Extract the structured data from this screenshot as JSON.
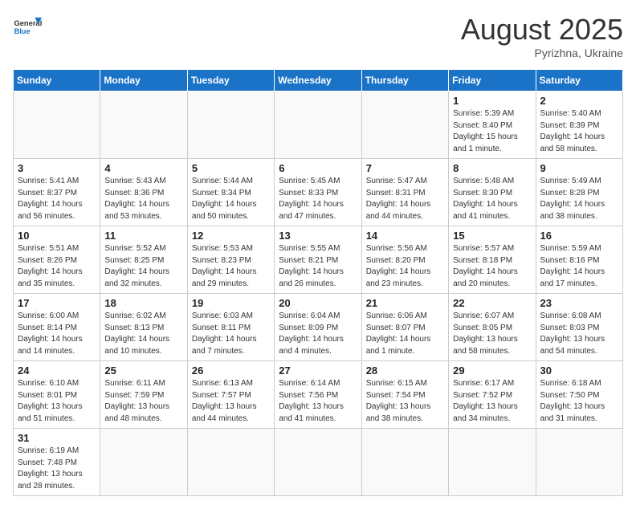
{
  "logo": {
    "text_general": "General",
    "text_blue": "Blue"
  },
  "header": {
    "month_year": "August 2025",
    "location": "Pyrizhna, Ukraine"
  },
  "weekdays": [
    "Sunday",
    "Monday",
    "Tuesday",
    "Wednesday",
    "Thursday",
    "Friday",
    "Saturday"
  ],
  "days": [
    {
      "date": 1,
      "col": 5,
      "sunrise": "5:39 AM",
      "sunset": "8:40 PM",
      "daylight": "15 hours and 1 minute."
    },
    {
      "date": 2,
      "col": 6,
      "sunrise": "5:40 AM",
      "sunset": "8:39 PM",
      "daylight": "14 hours and 58 minutes."
    },
    {
      "date": 3,
      "col": 0,
      "sunrise": "5:41 AM",
      "sunset": "8:37 PM",
      "daylight": "14 hours and 56 minutes."
    },
    {
      "date": 4,
      "col": 1,
      "sunrise": "5:43 AM",
      "sunset": "8:36 PM",
      "daylight": "14 hours and 53 minutes."
    },
    {
      "date": 5,
      "col": 2,
      "sunrise": "5:44 AM",
      "sunset": "8:34 PM",
      "daylight": "14 hours and 50 minutes."
    },
    {
      "date": 6,
      "col": 3,
      "sunrise": "5:45 AM",
      "sunset": "8:33 PM",
      "daylight": "14 hours and 47 minutes."
    },
    {
      "date": 7,
      "col": 4,
      "sunrise": "5:47 AM",
      "sunset": "8:31 PM",
      "daylight": "14 hours and 44 minutes."
    },
    {
      "date": 8,
      "col": 5,
      "sunrise": "5:48 AM",
      "sunset": "8:30 PM",
      "daylight": "14 hours and 41 minutes."
    },
    {
      "date": 9,
      "col": 6,
      "sunrise": "5:49 AM",
      "sunset": "8:28 PM",
      "daylight": "14 hours and 38 minutes."
    },
    {
      "date": 10,
      "col": 0,
      "sunrise": "5:51 AM",
      "sunset": "8:26 PM",
      "daylight": "14 hours and 35 minutes."
    },
    {
      "date": 11,
      "col": 1,
      "sunrise": "5:52 AM",
      "sunset": "8:25 PM",
      "daylight": "14 hours and 32 minutes."
    },
    {
      "date": 12,
      "col": 2,
      "sunrise": "5:53 AM",
      "sunset": "8:23 PM",
      "daylight": "14 hours and 29 minutes."
    },
    {
      "date": 13,
      "col": 3,
      "sunrise": "5:55 AM",
      "sunset": "8:21 PM",
      "daylight": "14 hours and 26 minutes."
    },
    {
      "date": 14,
      "col": 4,
      "sunrise": "5:56 AM",
      "sunset": "8:20 PM",
      "daylight": "14 hours and 23 minutes."
    },
    {
      "date": 15,
      "col": 5,
      "sunrise": "5:57 AM",
      "sunset": "8:18 PM",
      "daylight": "14 hours and 20 minutes."
    },
    {
      "date": 16,
      "col": 6,
      "sunrise": "5:59 AM",
      "sunset": "8:16 PM",
      "daylight": "14 hours and 17 minutes."
    },
    {
      "date": 17,
      "col": 0,
      "sunrise": "6:00 AM",
      "sunset": "8:14 PM",
      "daylight": "14 hours and 14 minutes."
    },
    {
      "date": 18,
      "col": 1,
      "sunrise": "6:02 AM",
      "sunset": "8:13 PM",
      "daylight": "14 hours and 10 minutes."
    },
    {
      "date": 19,
      "col": 2,
      "sunrise": "6:03 AM",
      "sunset": "8:11 PM",
      "daylight": "14 hours and 7 minutes."
    },
    {
      "date": 20,
      "col": 3,
      "sunrise": "6:04 AM",
      "sunset": "8:09 PM",
      "daylight": "14 hours and 4 minutes."
    },
    {
      "date": 21,
      "col": 4,
      "sunrise": "6:06 AM",
      "sunset": "8:07 PM",
      "daylight": "14 hours and 1 minute."
    },
    {
      "date": 22,
      "col": 5,
      "sunrise": "6:07 AM",
      "sunset": "8:05 PM",
      "daylight": "13 hours and 58 minutes."
    },
    {
      "date": 23,
      "col": 6,
      "sunrise": "6:08 AM",
      "sunset": "8:03 PM",
      "daylight": "13 hours and 54 minutes."
    },
    {
      "date": 24,
      "col": 0,
      "sunrise": "6:10 AM",
      "sunset": "8:01 PM",
      "daylight": "13 hours and 51 minutes."
    },
    {
      "date": 25,
      "col": 1,
      "sunrise": "6:11 AM",
      "sunset": "7:59 PM",
      "daylight": "13 hours and 48 minutes."
    },
    {
      "date": 26,
      "col": 2,
      "sunrise": "6:13 AM",
      "sunset": "7:57 PM",
      "daylight": "13 hours and 44 minutes."
    },
    {
      "date": 27,
      "col": 3,
      "sunrise": "6:14 AM",
      "sunset": "7:56 PM",
      "daylight": "13 hours and 41 minutes."
    },
    {
      "date": 28,
      "col": 4,
      "sunrise": "6:15 AM",
      "sunset": "7:54 PM",
      "daylight": "13 hours and 38 minutes."
    },
    {
      "date": 29,
      "col": 5,
      "sunrise": "6:17 AM",
      "sunset": "7:52 PM",
      "daylight": "13 hours and 34 minutes."
    },
    {
      "date": 30,
      "col": 6,
      "sunrise": "6:18 AM",
      "sunset": "7:50 PM",
      "daylight": "13 hours and 31 minutes."
    },
    {
      "date": 31,
      "col": 0,
      "sunrise": "6:19 AM",
      "sunset": "7:48 PM",
      "daylight": "13 hours and 28 minutes."
    }
  ],
  "labels": {
    "sunrise": "Sunrise:",
    "sunset": "Sunset:",
    "daylight": "Daylight:"
  }
}
